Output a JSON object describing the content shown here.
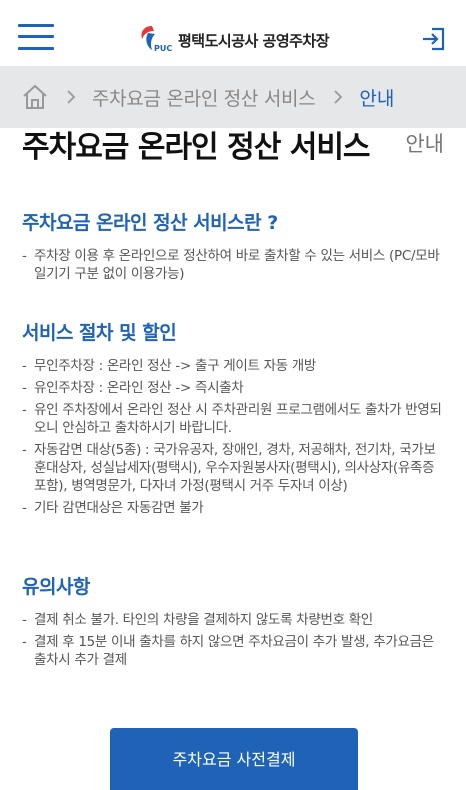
{
  "header": {
    "logo_text": "평택도시공사 공영주차장",
    "logo_mark_text": "PUC"
  },
  "breadcrumb": {
    "items": [
      "주차요금 온라인 정산 서비스",
      "안내"
    ]
  },
  "page": {
    "title": "주차요금 온라인 정산 서비스",
    "subtitle": "안내"
  },
  "sections": [
    {
      "heading": "주차요금 온라인 정산 서비스란 ?",
      "items": [
        "주차장 이용 후 온라인으로 정산하여 바로 출차할 수 있는 서비스 (PC/모바일기기 구분 없이 이용가능)"
      ]
    },
    {
      "heading": "서비스 절차 및 할인",
      "items": [
        "무인주차장 : 온라인 정산 -> 출구 게이트 자동 개방",
        "유인주차장 : 온라인 정산 -> 즉시출차",
        "유인 주차장에서 온라인 정산 시 주차관리원 프로그램에서도 출차가 반영되오니 안심하고 출차하시기 바랍니다.",
        "자동감면 대상(5종) : 국가유공자, 장애인, 경차, 저공해차, 전기차, 국가보훈대상자, 성실납세자(평택시), 우수자원봉사자(평택시), 의사상자(유족증 포함), 병역명문가, 다자녀 가정(평택시 거주 두자녀 이상)",
        "기타 감면대상은 자동감면 불가"
      ]
    },
    {
      "heading": "유의사항",
      "items": [
        "결제 취소 불가. 타인의 차량을 결제하지 않도록 차량번호 확인",
        "결제 후 15분 이내 출차를 하지 않으면 주차요금이 추가 발생, 추가요금은 출차시 추가 결제"
      ]
    }
  ],
  "pay_button": {
    "label": "주차요금 사전결제"
  },
  "colors": {
    "accent": "#1e63b8",
    "breadcrumb_bg": "#e6e7e9"
  },
  "icons": {
    "menu": "hamburger-menu-icon",
    "login": "login-icon",
    "home": "home-icon",
    "separator": "chevron-right-icon"
  }
}
